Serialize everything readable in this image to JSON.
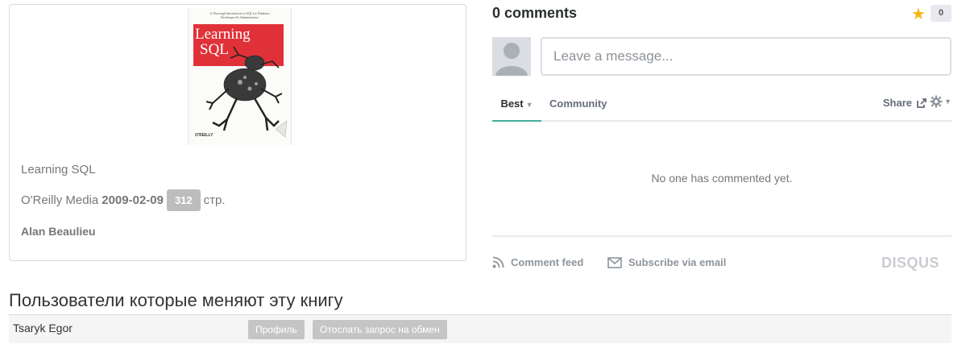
{
  "book": {
    "cover": {
      "tagline": "A Thorough Introduction to SQL for Database Developers & Administrators",
      "title_line1": "Learning",
      "title_line2": "SQL",
      "publisher_mark": "O'REILLY"
    },
    "title": "Learning SQL",
    "publisher": "O'Reilly Media",
    "date": "2009-02-09",
    "pages": "312",
    "pages_suffix": "стр.",
    "author": "Alan Beaulieu"
  },
  "comments": {
    "count_label": "0 comments",
    "star_count": "0",
    "input_placeholder": "Leave a message...",
    "tabs": {
      "best": "Best",
      "community": "Community"
    },
    "share_label": "Share",
    "empty_message": "No one has commented yet.",
    "footer": {
      "feed": "Comment feed",
      "subscribe": "Subscribe via email",
      "brand": "DISQUS"
    },
    "colors": {
      "star": "#f5b716",
      "active_tab": "#43b09a"
    }
  },
  "users_section": {
    "heading": "Пользователи которые меняют эту книгу",
    "rows": [
      {
        "name": "Tsaryk Egor",
        "profile_button": "Профиль",
        "request_button": "Отослать запрос на обмен"
      }
    ]
  }
}
